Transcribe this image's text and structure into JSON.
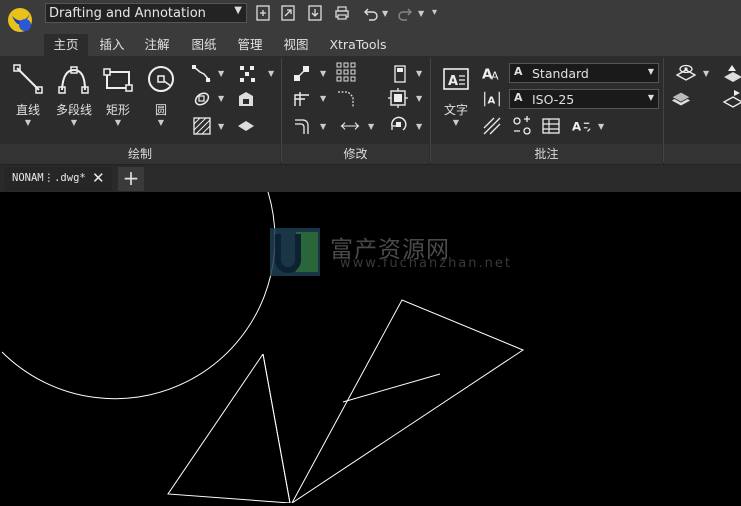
{
  "workspace": {
    "label": "Drafting and Annotation"
  },
  "tabs": [
    {
      "label": "主页",
      "active": true
    },
    {
      "label": "插入"
    },
    {
      "label": "注解"
    },
    {
      "label": "图纸"
    },
    {
      "label": "管理"
    },
    {
      "label": "视图"
    },
    {
      "label": "XtraTools"
    }
  ],
  "ribbon": {
    "draw": {
      "footer": "绘制",
      "line": "直线",
      "polyline": "多段线",
      "rectangle": "矩形",
      "circle": "圆"
    },
    "modify": {
      "footer": "修改"
    },
    "annotate": {
      "footer": "批注",
      "text": "文字",
      "text_style": "Standard",
      "dim_style": "ISO-25",
      "style_icon": "A"
    }
  },
  "document": {
    "tab_label": "NONAM⋮.dwg*",
    "close_glyph": "✕",
    "new_tab_glyph": "+"
  },
  "watermark": {
    "title": "富产资源网",
    "url": "www.fuchanzhan.net"
  },
  "colors": {
    "accent_tab": "#2c2c2c",
    "background": "#000000",
    "ribbon": "#2c2c2c"
  }
}
